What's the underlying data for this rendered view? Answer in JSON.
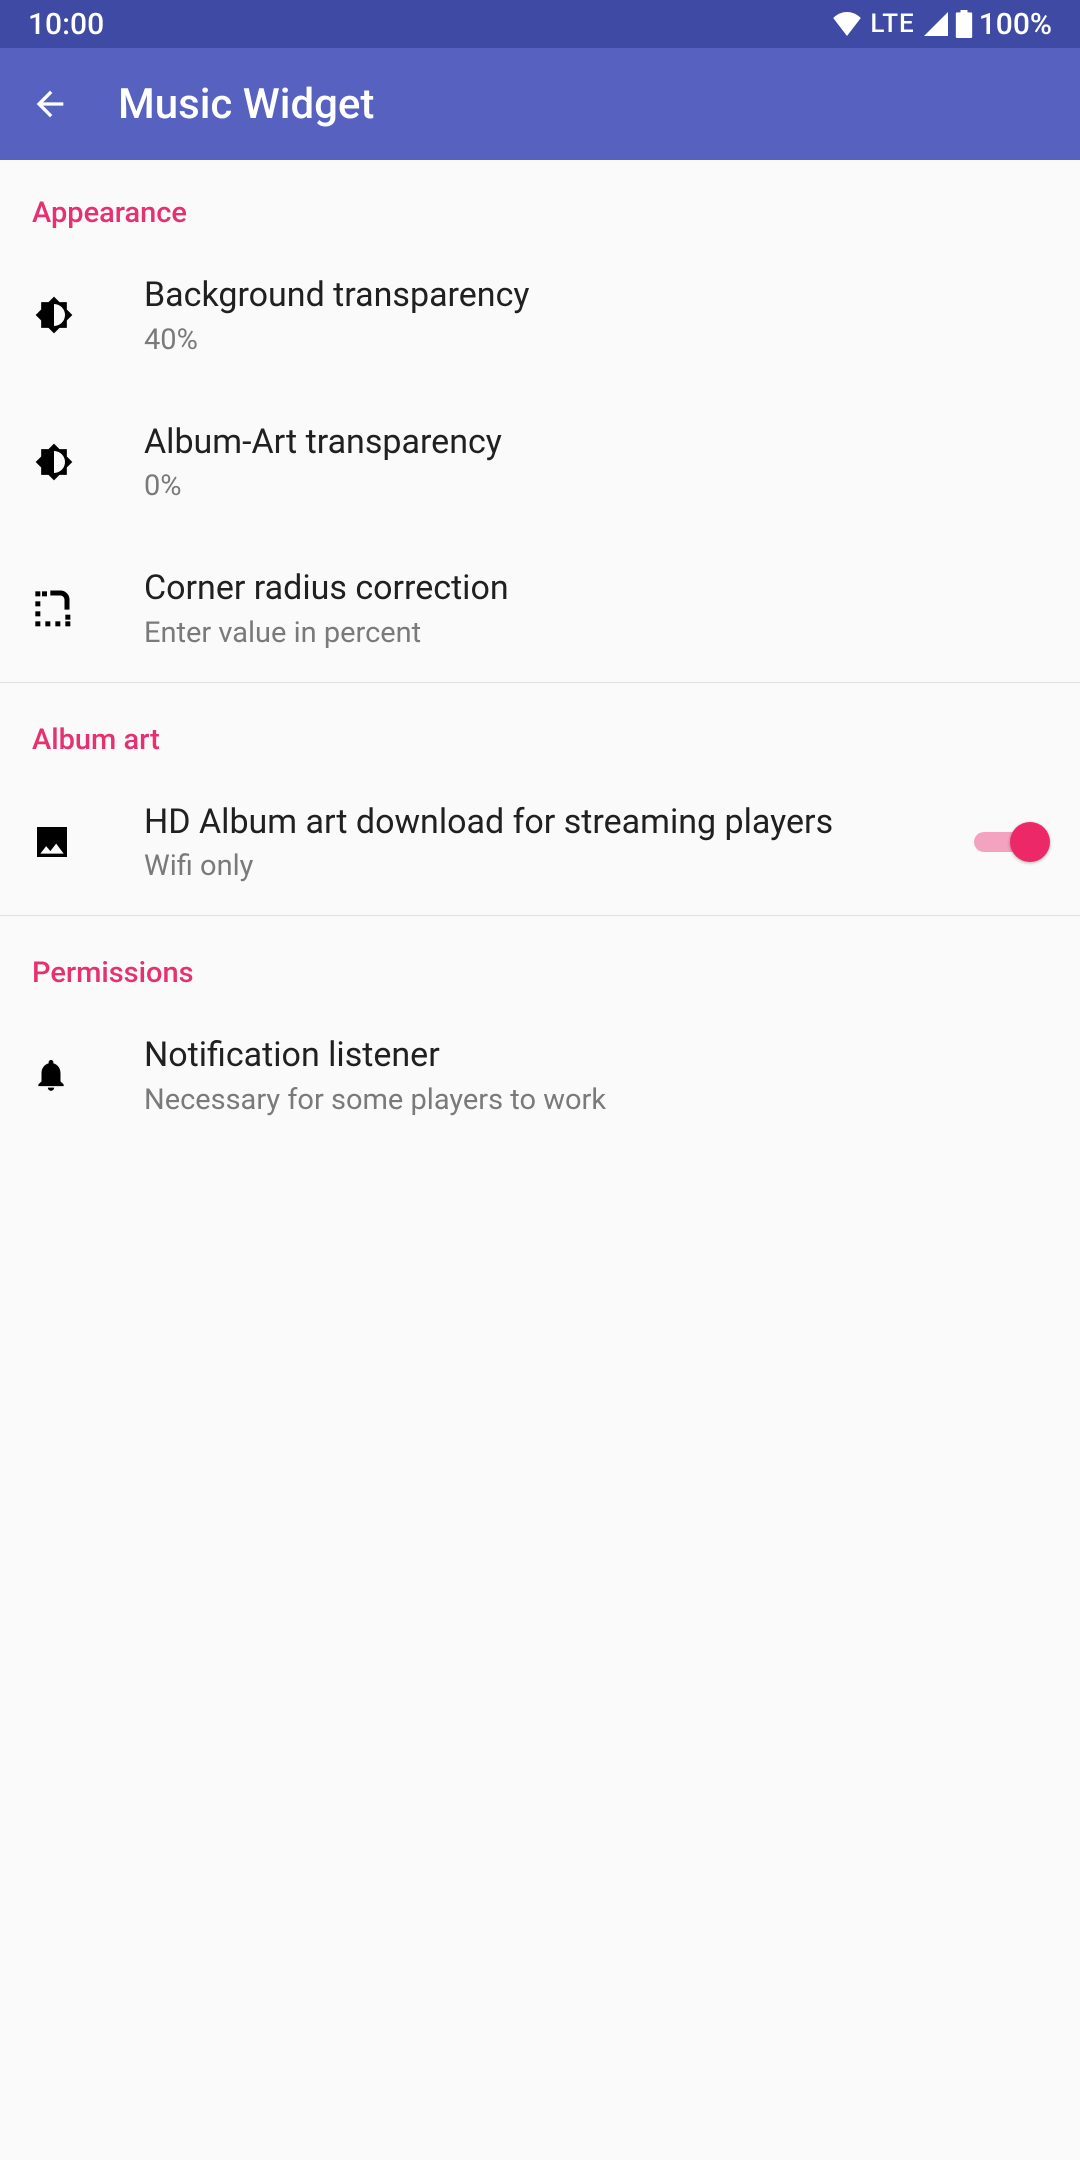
{
  "status": {
    "time": "10:00",
    "network": "LTE",
    "battery": "100%"
  },
  "appbar": {
    "title": "Music Widget"
  },
  "sections": {
    "appearance": {
      "header": "Appearance",
      "bg_trans": {
        "title": "Background transparency",
        "sub": "40%"
      },
      "art_trans": {
        "title": "Album-Art transparency",
        "sub": "0%"
      },
      "corner": {
        "title": "Corner radius correction",
        "sub": "Enter value in percent"
      }
    },
    "albumart": {
      "header": "Album art",
      "hd": {
        "title": "HD Album art download for streaming players",
        "sub": "Wifi only",
        "on": true
      }
    },
    "permissions": {
      "header": "Permissions",
      "notif": {
        "title": "Notification listener",
        "sub": "Necessary for some players to work"
      }
    }
  }
}
